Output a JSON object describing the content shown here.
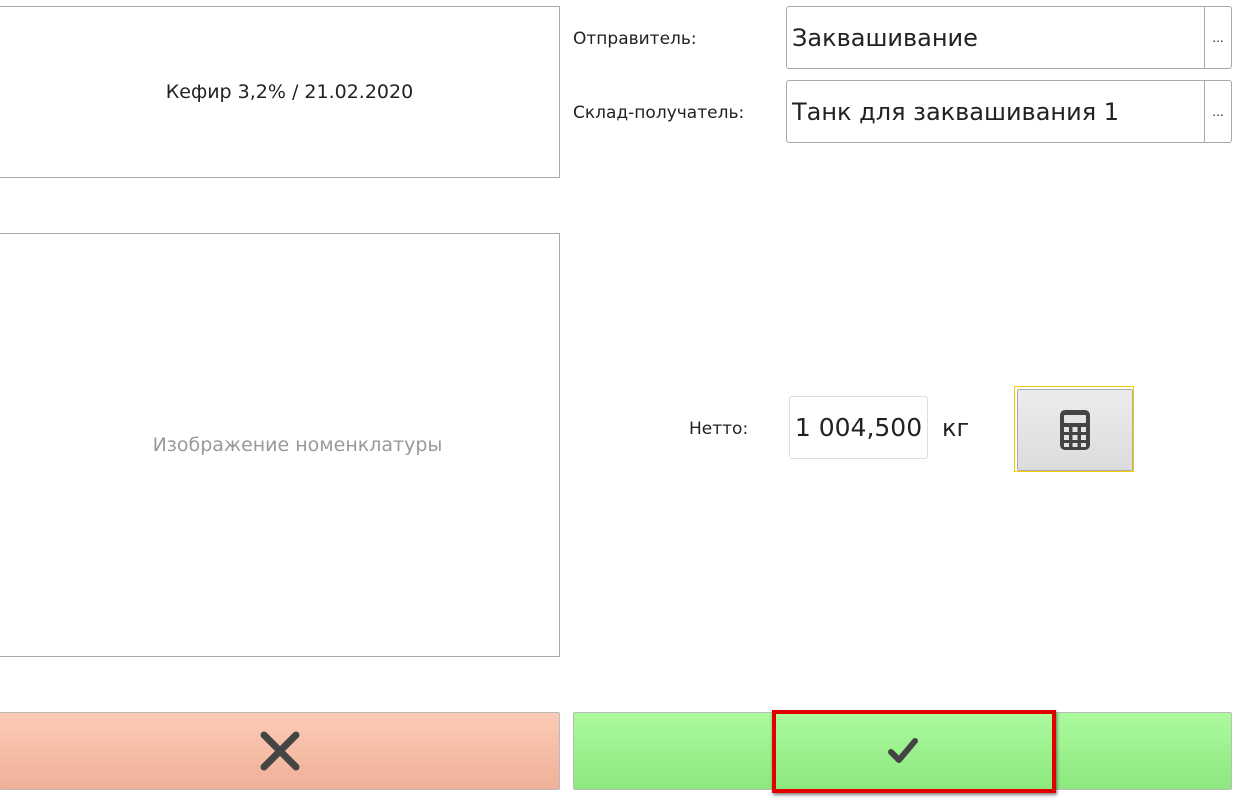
{
  "product": {
    "title": "Кефир 3,2% / 21.02.2020"
  },
  "image_placeholder": "Изображение номенклатуры",
  "sender": {
    "label": "Отправитель:",
    "value": "Заквашивание",
    "select_label": "..."
  },
  "receiver": {
    "label": "Склад-получатель:",
    "value": "Танк для заквашивания 1",
    "select_label": "..."
  },
  "netto": {
    "label": "Нетто:",
    "value": "1 004,500",
    "unit": "кг"
  },
  "icons": {
    "calculator": "calculator-icon",
    "cancel": "x-icon",
    "confirm": "check-icon"
  },
  "colors": {
    "cancel": "#f9bfa6",
    "confirm": "#9ef08f",
    "highlight": "#e00000",
    "focus": "#f5cc00"
  }
}
